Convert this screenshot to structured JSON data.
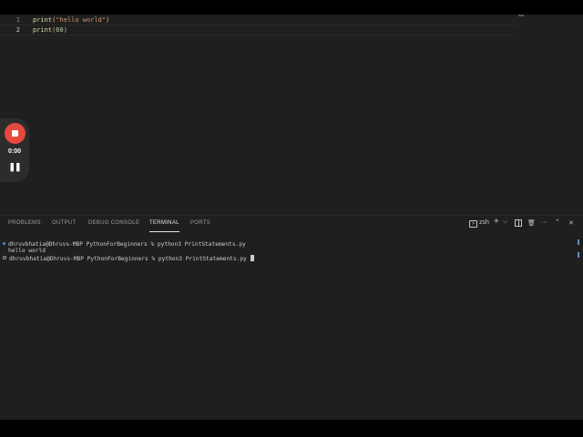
{
  "editor": {
    "lines": [
      {
        "num": "1",
        "fn": "print",
        "open": "(",
        "arg": "\"hello world\"",
        "close": ")"
      },
      {
        "num": "2",
        "fn": "print",
        "open": "(",
        "arg": "60",
        "close": ")"
      }
    ]
  },
  "recorder": {
    "time": "0:00",
    "pause_symbol": "❚❚"
  },
  "panel": {
    "tabs": [
      {
        "label": "PROBLEMS"
      },
      {
        "label": "OUTPUT"
      },
      {
        "label": "DEBUG CONSOLE"
      },
      {
        "label": "TERMINAL"
      },
      {
        "label": "PORTS"
      }
    ],
    "active_tab": "TERMINAL",
    "shell_label": "zsh",
    "add_symbol": "+",
    "split_symbol": "⌵",
    "trash_symbol": "🗑",
    "more_symbol": "···",
    "maximize_symbol": "⌃",
    "close_symbol": "✕"
  },
  "terminal": {
    "lines": [
      {
        "text": "dhruvbhatia@Dhruvs-MBP PythonForBeginners % python3 PrintStatements.py",
        "marker": "solid"
      },
      {
        "text": "hello world",
        "marker": "none"
      },
      {
        "text": "dhruvbhatia@Dhruvs-MBP PythonForBeginners % python3 PrintStatements.py ",
        "marker": "ring"
      }
    ]
  },
  "colors": {
    "editor_bg": "#1f1f1f",
    "function": "#dcdcaa",
    "string": "#ce9178",
    "number": "#b5cea8",
    "record_red": "#e5493f"
  }
}
